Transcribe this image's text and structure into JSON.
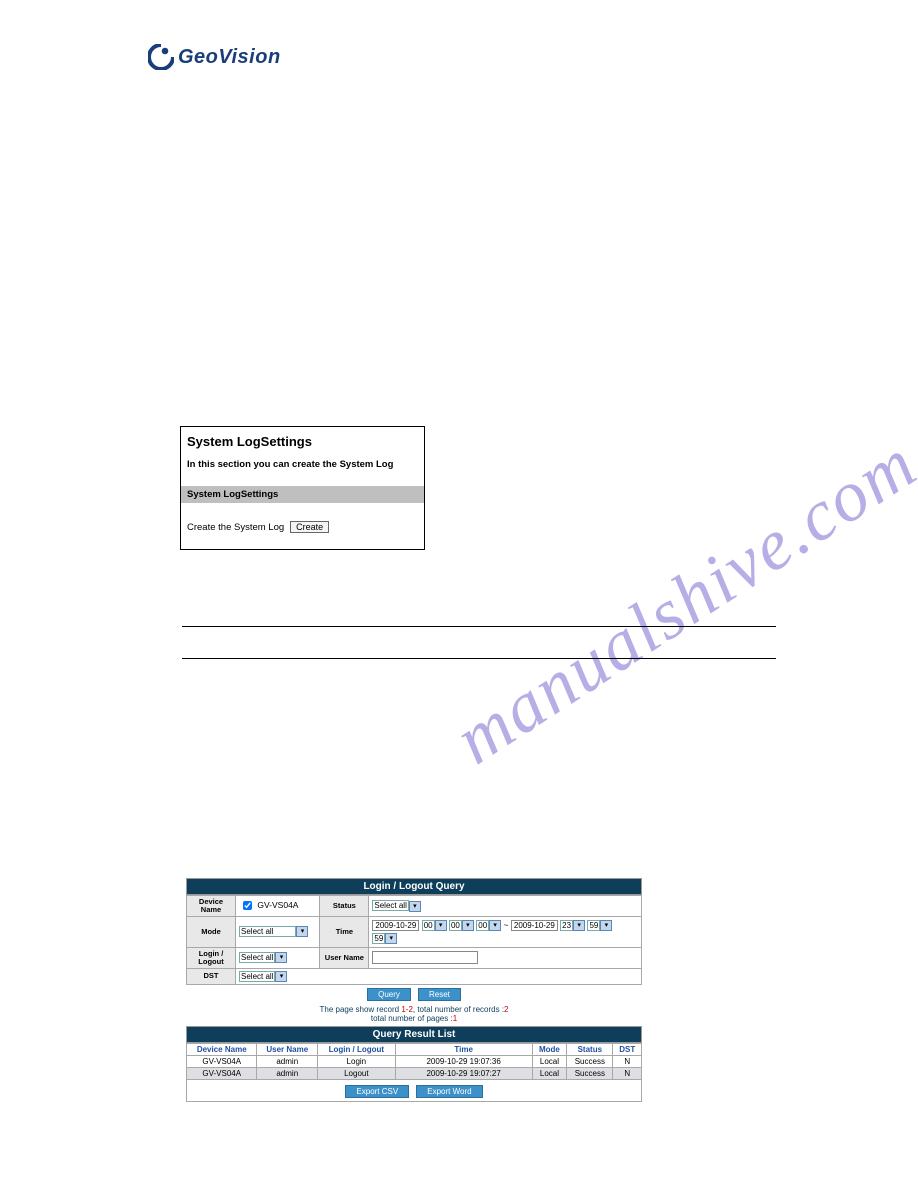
{
  "logo": {
    "text_a": "Geo",
    "text_b": "Vision"
  },
  "watermark": "manualshive.com",
  "panel1": {
    "title": "System LogSettings",
    "desc": "In this section you can create the System Log",
    "bar": "System LogSettings",
    "row_label": "Create the System Log",
    "create_btn": "Create"
  },
  "query": {
    "header": "Login / Logout Query",
    "labels": {
      "device_name": "Device\nName",
      "status": "Status",
      "mode": "Mode",
      "time": "Time",
      "login_logout": "Login /\nLogout",
      "user_name": "User Name",
      "dst": "DST"
    },
    "values": {
      "device_checkbox_label": "GV-VS04A",
      "status_select": "Select all",
      "mode_select": "Select all",
      "login_select": "Select all",
      "dst_select": "Select all",
      "date_from": "2009-10-29",
      "h_from": "00",
      "m_from": "00",
      "s_from": "00",
      "sep": "~",
      "date_to": "2009-10-29",
      "h_to": "23",
      "m_to": "59",
      "s_to": "59",
      "user_name_input": ""
    },
    "buttons": {
      "query": "Query",
      "reset": "Reset"
    },
    "records_line_a": "The page show record ",
    "records_range": "1-2",
    "records_mid": ", total number of records :",
    "records_count": "2",
    "records_line_b": "total number of pages :",
    "pages_count": "1",
    "result_header": "Query Result List",
    "columns": [
      "Device Name",
      "User Name",
      "Login / Logout",
      "Time",
      "Mode",
      "Status",
      "DST"
    ],
    "rows": [
      {
        "device": "GV-VS04A",
        "user": "admin",
        "action": "Login",
        "time": "2009-10-29 19:07:36",
        "mode": "Local",
        "status": "Success",
        "dst": "N"
      },
      {
        "device": "GV-VS04A",
        "user": "admin",
        "action": "Logout",
        "time": "2009-10-29 19:07:27",
        "mode": "Local",
        "status": "Success",
        "dst": "N"
      }
    ],
    "export_csv": "Export CSV",
    "export_word": "Export Word"
  }
}
